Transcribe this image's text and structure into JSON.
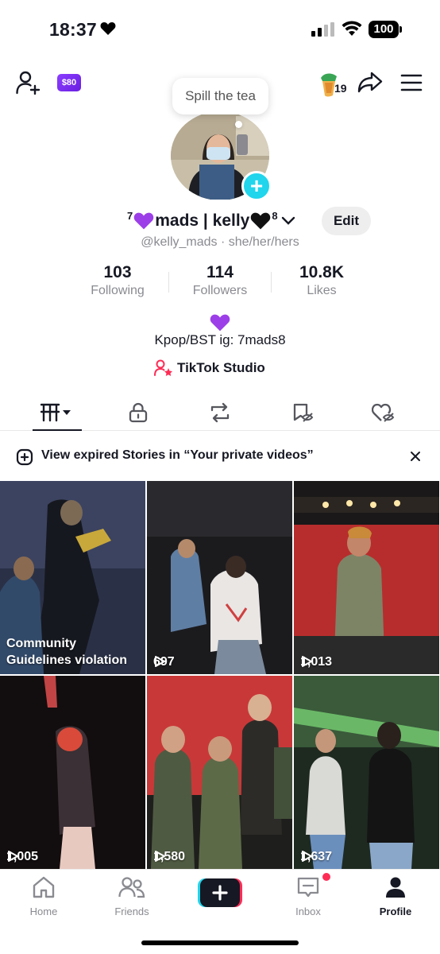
{
  "status_bar": {
    "time": "18:37",
    "battery": "100"
  },
  "top_bar": {
    "coin_badge": "$80",
    "streak_count": "19"
  },
  "tooltip": {
    "text": "Spill the tea"
  },
  "profile": {
    "name_prefix_sup": "7",
    "name_text": "mads | kelly",
    "name_suffix_sup": "8",
    "edit_label": "Edit",
    "handle": "@kelly_mads · she/her/hers",
    "bio": "Kpop/BST ig: 7mads8",
    "studio_label": "TikTok Studio"
  },
  "stats": [
    {
      "value": "103",
      "label": "Following"
    },
    {
      "value": "114",
      "label": "Followers"
    },
    {
      "value": "10.8K",
      "label": "Likes"
    }
  ],
  "banner": {
    "text": "View expired Stories in “Your private videos”"
  },
  "videos": [
    {
      "violation": "Community Guidelines violation",
      "views": ""
    },
    {
      "views": "697"
    },
    {
      "views": "1,013"
    },
    {
      "views": "1,005"
    },
    {
      "views": "1,580"
    },
    {
      "views": "1,637"
    }
  ],
  "nav": [
    {
      "label": "Home"
    },
    {
      "label": "Friends"
    },
    {
      "label": "Inbox"
    },
    {
      "label": "Profile"
    }
  ],
  "colors": {
    "accent_cyan": "#20d5ec",
    "accent_pink": "#fe2c55",
    "coin_purple": "#7b2ff0"
  }
}
